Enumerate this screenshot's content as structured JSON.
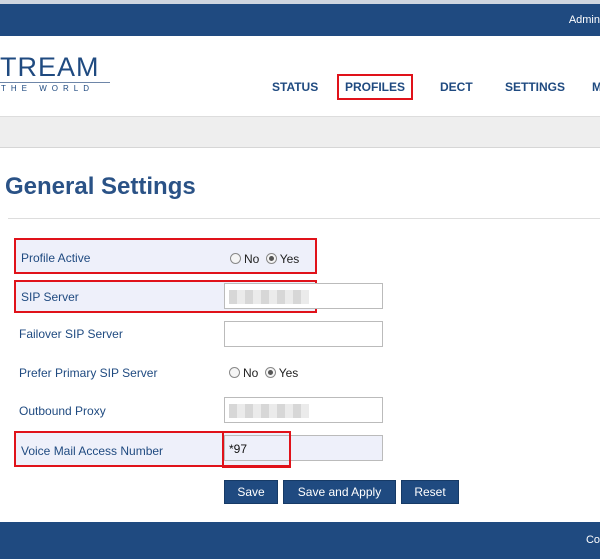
{
  "header": {
    "admin_text": "Admin"
  },
  "logo": {
    "line1": "TREAM",
    "line2": "THE WORLD"
  },
  "nav": [
    {
      "label": "STATUS",
      "active": false
    },
    {
      "label": "PROFILES",
      "active": true
    },
    {
      "label": "DECT",
      "active": false
    },
    {
      "label": "SETTINGS",
      "active": false
    },
    {
      "label": "M",
      "active": false
    }
  ],
  "page": {
    "title": "General Settings"
  },
  "form": {
    "profile_active": {
      "label": "Profile Active",
      "options": [
        "No",
        "Yes"
      ],
      "selected": "Yes"
    },
    "sip_server": {
      "label": "SIP Server",
      "value": ""
    },
    "failover_sip_server": {
      "label": "Failover SIP Server",
      "value": ""
    },
    "prefer_primary": {
      "label": "Prefer Primary SIP Server",
      "options": [
        "No",
        "Yes"
      ],
      "selected": "Yes"
    },
    "outbound_proxy": {
      "label": "Outbound Proxy",
      "value": ""
    },
    "voicemail": {
      "label": "Voice Mail Access Number",
      "value": "*97"
    }
  },
  "buttons": {
    "save": "Save",
    "save_apply": "Save and Apply",
    "reset": "Reset"
  },
  "footer": {
    "text": "Co"
  },
  "colors": {
    "brand": "#1f4a80",
    "highlight": "#e0121a",
    "row_bg": "#eef0fa"
  }
}
